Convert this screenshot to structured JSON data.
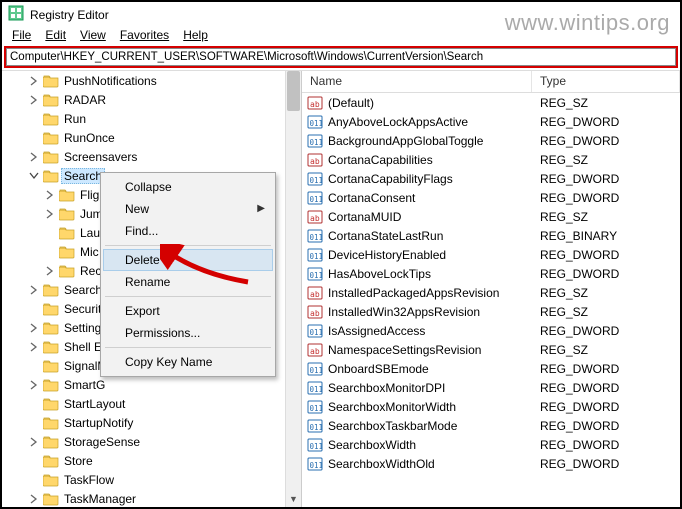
{
  "watermark": "www.wintips.org",
  "window_title": "Registry Editor",
  "menubar": [
    "File",
    "Edit",
    "View",
    "Favorites",
    "Help"
  ],
  "address": "Computer\\HKEY_CURRENT_USER\\SOFTWARE\\Microsoft\\Windows\\CurrentVersion\\Search",
  "tree": {
    "items": [
      {
        "label": "PushNotifications",
        "twisty": ">",
        "depth": 1
      },
      {
        "label": "RADAR",
        "twisty": ">",
        "depth": 1
      },
      {
        "label": "Run",
        "twisty": "",
        "depth": 1
      },
      {
        "label": "RunOnce",
        "twisty": "",
        "depth": 1
      },
      {
        "label": "Screensavers",
        "twisty": ">",
        "depth": 1
      },
      {
        "label": "Search",
        "twisty": "v",
        "depth": 1,
        "selected": true
      },
      {
        "label": "Fligh",
        "twisty": ">",
        "depth": 2
      },
      {
        "label": "Jum",
        "twisty": ">",
        "depth": 2
      },
      {
        "label": "Laur",
        "twisty": "",
        "depth": 2
      },
      {
        "label": "Mic",
        "twisty": "",
        "depth": 2
      },
      {
        "label": "Reco",
        "twisty": ">",
        "depth": 2
      },
      {
        "label": "SearchS",
        "twisty": ">",
        "depth": 1
      },
      {
        "label": "Securit",
        "twisty": "",
        "depth": 1
      },
      {
        "label": "Setting",
        "twisty": ">",
        "depth": 1
      },
      {
        "label": "Shell Ex",
        "twisty": ">",
        "depth": 1
      },
      {
        "label": "SignalM",
        "twisty": "",
        "depth": 1
      },
      {
        "label": "SmartG",
        "twisty": ">",
        "depth": 1
      },
      {
        "label": "StartLayout",
        "twisty": "",
        "depth": 1
      },
      {
        "label": "StartupNotify",
        "twisty": "",
        "depth": 1
      },
      {
        "label": "StorageSense",
        "twisty": ">",
        "depth": 1
      },
      {
        "label": "Store",
        "twisty": "",
        "depth": 1
      },
      {
        "label": "TaskFlow",
        "twisty": "",
        "depth": 1
      },
      {
        "label": "TaskManager",
        "twisty": ">",
        "depth": 1
      }
    ]
  },
  "list": {
    "columns": {
      "name": "Name",
      "type": "Type"
    },
    "rows": [
      {
        "icon": "sz",
        "name": "(Default)",
        "type": "REG_SZ"
      },
      {
        "icon": "dw",
        "name": "AnyAboveLockAppsActive",
        "type": "REG_DWORD"
      },
      {
        "icon": "dw",
        "name": "BackgroundAppGlobalToggle",
        "type": "REG_DWORD"
      },
      {
        "icon": "sz",
        "name": "CortanaCapabilities",
        "type": "REG_SZ"
      },
      {
        "icon": "dw",
        "name": "CortanaCapabilityFlags",
        "type": "REG_DWORD"
      },
      {
        "icon": "dw",
        "name": "CortanaConsent",
        "type": "REG_DWORD"
      },
      {
        "icon": "sz",
        "name": "CortanaMUID",
        "type": "REG_SZ"
      },
      {
        "icon": "bn",
        "name": "CortanaStateLastRun",
        "type": "REG_BINARY"
      },
      {
        "icon": "dw",
        "name": "DeviceHistoryEnabled",
        "type": "REG_DWORD"
      },
      {
        "icon": "dw",
        "name": "HasAboveLockTips",
        "type": "REG_DWORD"
      },
      {
        "icon": "sz",
        "name": "InstalledPackagedAppsRevision",
        "type": "REG_SZ"
      },
      {
        "icon": "sz",
        "name": "InstalledWin32AppsRevision",
        "type": "REG_SZ"
      },
      {
        "icon": "dw",
        "name": "IsAssignedAccess",
        "type": "REG_DWORD"
      },
      {
        "icon": "sz",
        "name": "NamespaceSettingsRevision",
        "type": "REG_SZ"
      },
      {
        "icon": "dw",
        "name": "OnboardSBEmode",
        "type": "REG_DWORD"
      },
      {
        "icon": "dw",
        "name": "SearchboxMonitorDPI",
        "type": "REG_DWORD"
      },
      {
        "icon": "dw",
        "name": "SearchboxMonitorWidth",
        "type": "REG_DWORD"
      },
      {
        "icon": "dw",
        "name": "SearchboxTaskbarMode",
        "type": "REG_DWORD"
      },
      {
        "icon": "dw",
        "name": "SearchboxWidth",
        "type": "REG_DWORD"
      },
      {
        "icon": "dw",
        "name": "SearchboxWidthOld",
        "type": "REG_DWORD"
      }
    ]
  },
  "context_menu": {
    "items": [
      {
        "label": "Collapse"
      },
      {
        "label": "New",
        "submenu": true
      },
      {
        "label": "Find..."
      },
      {
        "sep": true
      },
      {
        "label": "Delete",
        "hover": true
      },
      {
        "label": "Rename"
      },
      {
        "sep": true
      },
      {
        "label": "Export"
      },
      {
        "label": "Permissions..."
      },
      {
        "sep": true
      },
      {
        "label": "Copy Key Name"
      }
    ]
  },
  "colors": {
    "highlight_border": "#d40000",
    "sel_bg": "#cde8ff"
  }
}
